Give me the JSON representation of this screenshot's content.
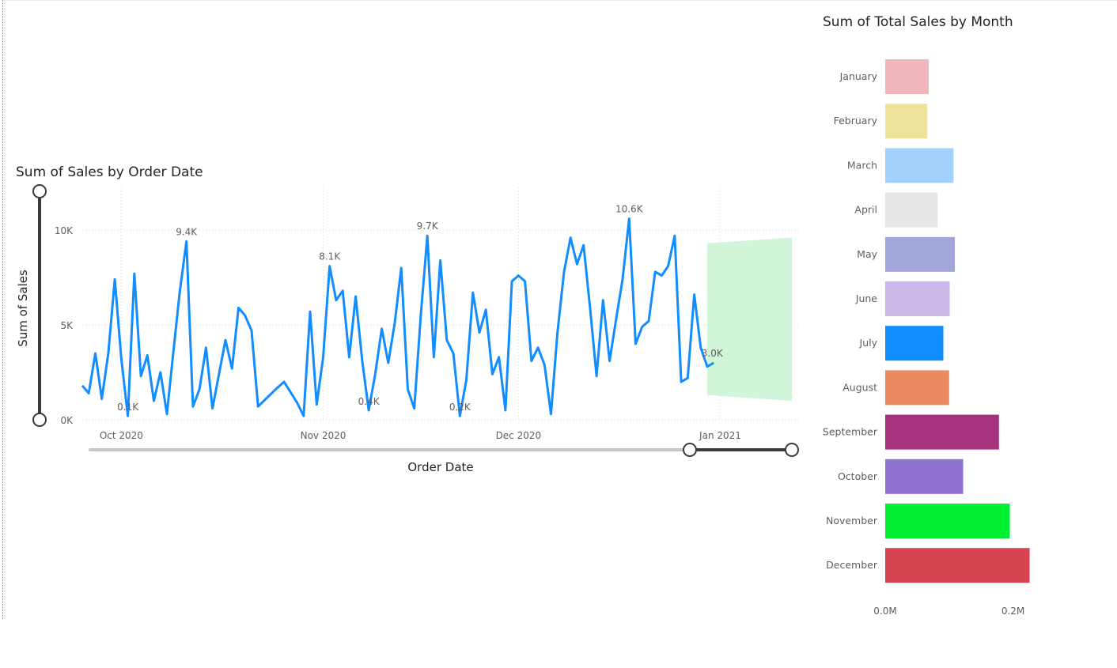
{
  "line_visual": {
    "title": "Sum of Sales by Order Date",
    "x_axis_title": "Order Date",
    "y_axis_title": "Sum of Sales"
  },
  "bar_visual": {
    "title": "Sum of Total Sales by Month"
  },
  "colors": {
    "line": "#118dff",
    "forecast_band": "#d1f5d8",
    "slider_track": "#c8c6c4",
    "slider_active": "#3b3a39"
  },
  "chart_data": [
    {
      "type": "line",
      "title": "Sum of Sales by Order Date",
      "xlabel": "Order Date",
      "ylabel": "Sum of Sales",
      "x_ticks": [
        "Oct 2020",
        "Nov 2020",
        "Dec 2020",
        "Jan 2021"
      ],
      "y_ticks": [
        "0K",
        "5K",
        "10K"
      ],
      "ylim": [
        0,
        12000
      ],
      "xlim": [
        "2020-09-25",
        "2021-01-12"
      ],
      "grid": true,
      "forecast_band": {
        "start": "2020-12-30",
        "end": "2021-01-12",
        "lower_start": 1300,
        "lower_end": 1000,
        "upper_start": 9300,
        "upper_end": 9600
      },
      "series": [
        {
          "values": [
            [
              "2020-09-25",
              1800
            ],
            [
              "2020-09-26",
              1400
            ],
            [
              "2020-09-27",
              3500
            ],
            [
              "2020-09-28",
              1100
            ],
            [
              "2020-09-29",
              3500
            ],
            [
              "2020-09-30",
              7400
            ],
            [
              "2020-10-01",
              3200
            ],
            [
              "2020-10-02",
              200
            ],
            [
              "2020-10-03",
              7700
            ],
            [
              "2020-10-04",
              2300
            ],
            [
              "2020-10-05",
              3400
            ],
            [
              "2020-10-06",
              1000
            ],
            [
              "2020-10-07",
              2500
            ],
            [
              "2020-10-08",
              300
            ],
            [
              "2020-10-09",
              3600
            ],
            [
              "2020-10-10",
              6800
            ],
            [
              "2020-10-11",
              9400
            ],
            [
              "2020-10-12",
              700
            ],
            [
              "2020-10-13",
              1600
            ],
            [
              "2020-10-14",
              3800
            ],
            [
              "2020-10-15",
              600
            ],
            [
              "2020-10-16",
              2400
            ],
            [
              "2020-10-17",
              4200
            ],
            [
              "2020-10-18",
              2700
            ],
            [
              "2020-10-19",
              5900
            ],
            [
              "2020-10-20",
              5500
            ],
            [
              "2020-10-21",
              4700
            ],
            [
              "2020-10-22",
              700
            ],
            [
              "2020-10-25",
              1700
            ],
            [
              "2020-10-26",
              2000
            ],
            [
              "2020-10-28",
              900
            ],
            [
              "2020-10-29",
              200
            ],
            [
              "2020-10-30",
              5700
            ],
            [
              "2020-10-31",
              800
            ],
            [
              "2020-11-01",
              3300
            ],
            [
              "2020-11-02",
              8100
            ],
            [
              "2020-11-03",
              6300
            ],
            [
              "2020-11-04",
              6800
            ],
            [
              "2020-11-05",
              3300
            ],
            [
              "2020-11-06",
              6500
            ],
            [
              "2020-11-07",
              3100
            ],
            [
              "2020-11-08",
              500
            ],
            [
              "2020-11-09",
              2400
            ],
            [
              "2020-11-10",
              4800
            ],
            [
              "2020-11-11",
              3000
            ],
            [
              "2020-11-12",
              5100
            ],
            [
              "2020-11-13",
              8000
            ],
            [
              "2020-11-14",
              1600
            ],
            [
              "2020-11-15",
              600
            ],
            [
              "2020-11-16",
              5500
            ],
            [
              "2020-11-17",
              9700
            ],
            [
              "2020-11-18",
              3300
            ],
            [
              "2020-11-19",
              8400
            ],
            [
              "2020-11-20",
              4200
            ],
            [
              "2020-11-21",
              3500
            ],
            [
              "2020-11-22",
              200
            ],
            [
              "2020-11-23",
              2100
            ],
            [
              "2020-11-24",
              6700
            ],
            [
              "2020-11-25",
              4600
            ],
            [
              "2020-11-26",
              5800
            ],
            [
              "2020-11-27",
              2400
            ],
            [
              "2020-11-28",
              3300
            ],
            [
              "2020-11-29",
              500
            ],
            [
              "2020-11-30",
              7300
            ],
            [
              "2020-12-01",
              7600
            ],
            [
              "2020-12-02",
              7300
            ],
            [
              "2020-12-03",
              3100
            ],
            [
              "2020-12-04",
              3800
            ],
            [
              "2020-12-05",
              2900
            ],
            [
              "2020-12-06",
              300
            ],
            [
              "2020-12-07",
              4600
            ],
            [
              "2020-12-08",
              7800
            ],
            [
              "2020-12-09",
              9600
            ],
            [
              "2020-12-10",
              8200
            ],
            [
              "2020-12-11",
              9200
            ],
            [
              "2020-12-12",
              5900
            ],
            [
              "2020-12-13",
              2300
            ],
            [
              "2020-12-14",
              6300
            ],
            [
              "2020-12-15",
              3100
            ],
            [
              "2020-12-16",
              5300
            ],
            [
              "2020-12-17",
              7400
            ],
            [
              "2020-12-18",
              10600
            ],
            [
              "2020-12-19",
              4000
            ],
            [
              "2020-12-20",
              4900
            ],
            [
              "2020-12-21",
              5200
            ],
            [
              "2020-12-22",
              7800
            ],
            [
              "2020-12-23",
              7600
            ],
            [
              "2020-12-24",
              8100
            ],
            [
              "2020-12-25",
              9700
            ],
            [
              "2020-12-26",
              2000
            ],
            [
              "2020-12-27",
              2200
            ],
            [
              "2020-12-28",
              6600
            ],
            [
              "2020-12-29",
              3800
            ],
            [
              "2020-12-30",
              2800
            ],
            [
              "2020-12-31",
              3000
            ]
          ]
        }
      ],
      "data_labels": [
        {
          "x": "2020-10-11",
          "y": 9400,
          "text": "9.4K",
          "dx": 0
        },
        {
          "x": "2020-11-02",
          "y": 8100,
          "text": "8.1K",
          "dx": 0
        },
        {
          "x": "2020-11-17",
          "y": 9700,
          "text": "9.7K",
          "dx": 0
        },
        {
          "x": "2020-12-18",
          "y": 10600,
          "text": "10.6K",
          "dx": 0
        },
        {
          "x": "2020-10-02",
          "y": 200,
          "text": "0.1K",
          "dx": 0
        },
        {
          "x": "2020-11-08",
          "y": 500,
          "text": "0.4K",
          "dx": 0
        },
        {
          "x": "2020-11-22",
          "y": 200,
          "text": "0.2K",
          "dx": 0
        },
        {
          "x": "2020-12-31",
          "y": 3000,
          "text": "3.0K",
          "dx": -2
        }
      ],
      "zoom_slider": {
        "y_range": [
          0,
          1
        ],
        "x_range": [
          0.85,
          1.0
        ]
      }
    },
    {
      "type": "bar",
      "orientation": "horizontal",
      "title": "Sum of Total Sales by Month",
      "xlim": [
        0,
        260000
      ],
      "x_ticks": [
        {
          "value": 0,
          "label": "0.0M"
        },
        {
          "value": 200000,
          "label": "0.2M"
        }
      ],
      "categories": [
        "January",
        "February",
        "March",
        "April",
        "May",
        "June",
        "July",
        "August",
        "September",
        "October",
        "November",
        "December"
      ],
      "values": [
        68000,
        66000,
        107000,
        82000,
        109000,
        101000,
        91000,
        100000,
        178000,
        122000,
        195000,
        226000
      ],
      "colors": [
        "#f0b6bb",
        "#eee29a",
        "#a4d2ff",
        "#e6e6e6",
        "#a1a5d8",
        "#c9b8e8",
        "#118dff",
        "#e98a61",
        "#a4327c",
        "#9173d2",
        "#00f031",
        "#d64550"
      ]
    }
  ]
}
